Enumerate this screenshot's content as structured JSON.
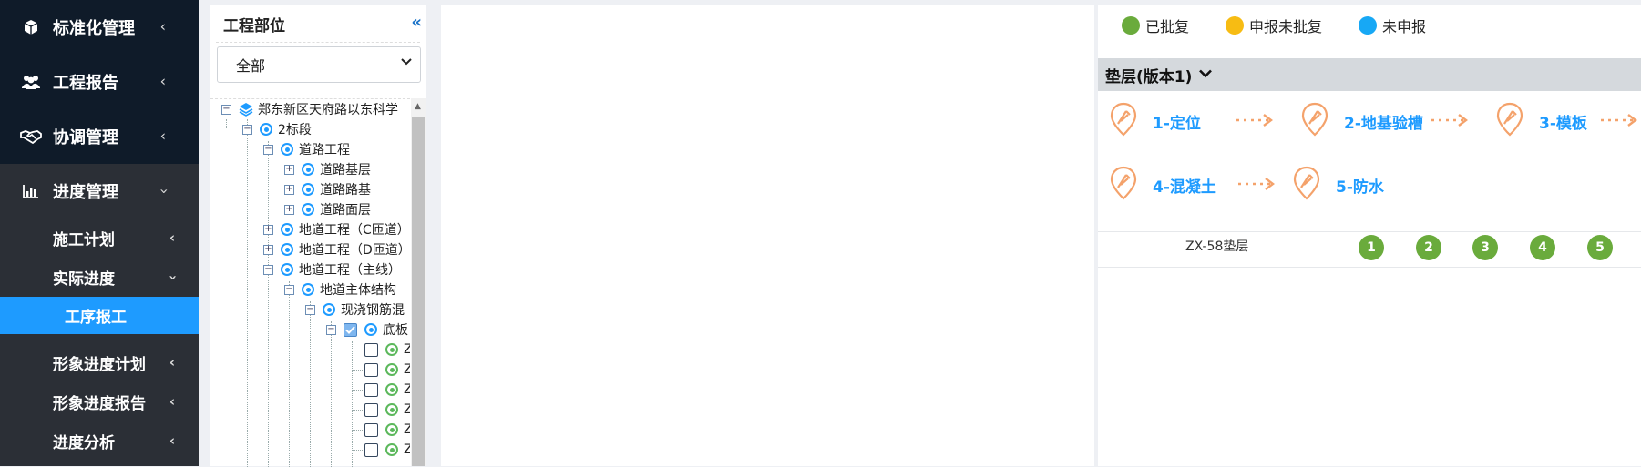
{
  "sidebar": {
    "top_items": [
      {
        "label": "标准化管理",
        "icon": "cube-icon"
      },
      {
        "label": "工程报告",
        "icon": "users-icon"
      },
      {
        "label": "协调管理",
        "icon": "handshake-icon"
      }
    ],
    "progress": {
      "label": "进度管理",
      "icon": "bar-chart-icon"
    },
    "sub_items": {
      "plan": "施工计划",
      "actual": "实际进度",
      "active": "工序报工",
      "image_plan": "形象进度计划",
      "image_report": "形象进度报告",
      "analysis": "进度分析"
    }
  },
  "tree": {
    "title": "工程部位",
    "select_value": "全部",
    "nodes": {
      "root": "郑东新区天府路以东科学",
      "bid": "2标段",
      "road": "道路工程",
      "road_base": "道路基层",
      "road_bed": "道路路基",
      "road_surface": "道路面层",
      "tunnel_c": "地道工程（C匝道）",
      "tunnel_d": "地道工程（D匝道）",
      "tunnel_main": "地道工程（主线）",
      "tunnel_struct": "地道主体结构",
      "cast_concrete": "现浇钢筋混",
      "bottom_slab": "底板",
      "leaf": "Z"
    }
  },
  "legend": [
    {
      "label": "已批复",
      "color": "#6aab3c"
    },
    {
      "label": "申报未批复",
      "color": "#f7bc13"
    },
    {
      "label": "未申报",
      "color": "#17a8f5"
    }
  ],
  "layer": {
    "title": "垫层(版本1)"
  },
  "steps": [
    "1-定位",
    "2-地基验槽",
    "3-模板",
    "4-混凝土",
    "5-防水"
  ],
  "table_row": {
    "name": "ZX-58垫层",
    "statuses": [
      "1",
      "2",
      "3",
      "4",
      "5"
    ]
  },
  "colors": {
    "accent": "#1e9bff",
    "sidebar_bg": "#2b2f36",
    "sidebar_top": "#0f1b29",
    "step_icon": "#f4a26b",
    "approved": "#6aab3c"
  }
}
